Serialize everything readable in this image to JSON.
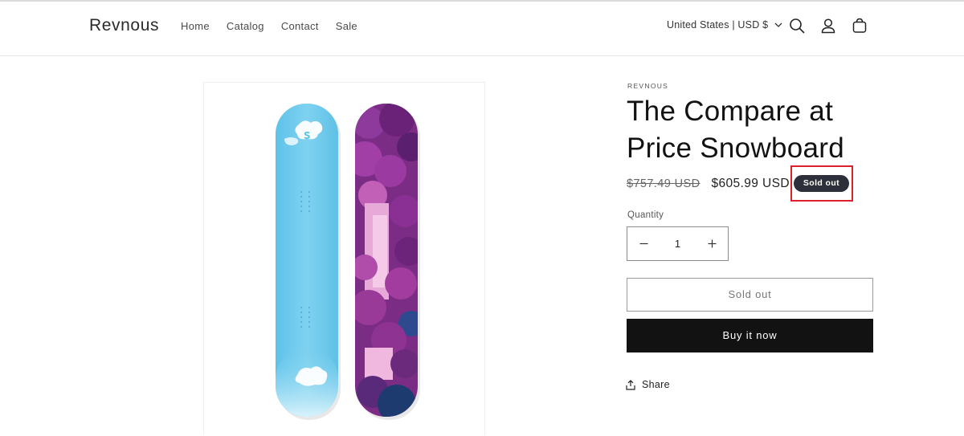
{
  "header": {
    "logo": "Revnous",
    "nav": [
      {
        "label": "Home"
      },
      {
        "label": "Catalog"
      },
      {
        "label": "Contact"
      },
      {
        "label": "Sale"
      }
    ],
    "locale_label": "United States | USD $",
    "icons": [
      "search-icon",
      "account-icon",
      "cart-icon"
    ]
  },
  "product": {
    "vendor": "REVNOUS",
    "title": "The Compare at Price Snowboard",
    "compare_price": "$757.49 USD",
    "price": "$605.99 USD",
    "badge": "Sold out",
    "quantity_label": "Quantity",
    "quantity_value": "1",
    "sold_out_button": "Sold out",
    "buy_now_button": "Buy it now",
    "share_label": "Share"
  },
  "colors": {
    "badge_bg": "#2d303a",
    "highlight_box": "#d8212d",
    "buy_button_bg": "#121212",
    "board_left": "#6ec9eb",
    "board_right": "#7a2e86"
  }
}
